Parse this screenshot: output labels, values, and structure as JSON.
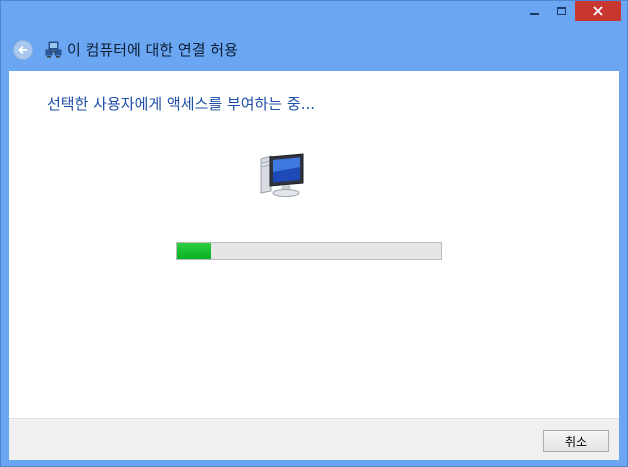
{
  "window": {
    "title": "이 컴퓨터에 대한 연결 허용",
    "accent_color": "#6aa6f2",
    "close_color": "#c7372f"
  },
  "icons": {
    "back": "back-arrow-icon",
    "header": "network-computers-icon",
    "main": "computer-monitor-icon"
  },
  "content": {
    "status": "선택한 사용자에게 액세스를 부여하는 중..."
  },
  "progress": {
    "value_percent": 13,
    "color": "#06b025"
  },
  "footer": {
    "cancel_label": "취소"
  }
}
